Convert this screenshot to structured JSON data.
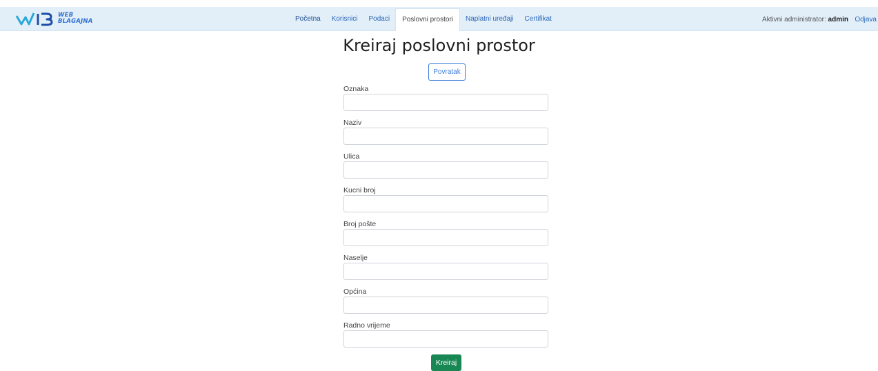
{
  "brand": {
    "mark": "W/B",
    "line1": "WEB",
    "line2": "BLAGAJNA",
    "color": "#2f6fd2"
  },
  "nav": {
    "items": [
      "Početna",
      "Korisnici",
      "Podaci",
      "Poslovni prostori",
      "Naplatni uređaji",
      "Certifikat"
    ],
    "active_index": 3
  },
  "admin": {
    "prefix": "Aktivni administrator:",
    "username": "admin"
  },
  "logout_label": "Odjava",
  "page_title": "Kreiraj poslovni prostor",
  "back_label": "Povratak",
  "form": {
    "fields": [
      {
        "label": "Oznaka",
        "value": ""
      },
      {
        "label": "Naziv",
        "value": ""
      },
      {
        "label": "Ulica",
        "value": ""
      },
      {
        "label": "Kucni broj",
        "value": ""
      },
      {
        "label": "Broj pošte",
        "value": ""
      },
      {
        "label": "Naselje",
        "value": ""
      },
      {
        "label": "Općina",
        "value": ""
      },
      {
        "label": "Radno vrijeme",
        "value": ""
      }
    ],
    "submit_label": "Kreiraj"
  },
  "colors": {
    "navbar": "#e2eff9",
    "link": "#2a66b8",
    "primary": "#3b7dd8",
    "success": "#198754"
  }
}
